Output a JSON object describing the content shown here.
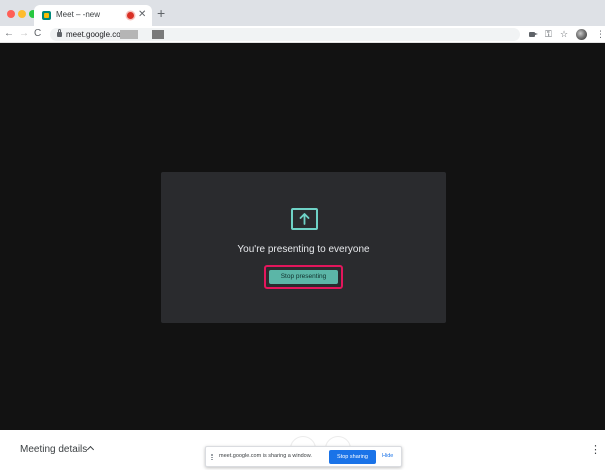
{
  "browser": {
    "tab": {
      "title": "Meet – -new"
    },
    "address_bar": {
      "url": "meet.google.com/"
    }
  },
  "presenting": {
    "heading": "You're presenting to everyone",
    "stop_button": "Stop presenting"
  },
  "bottom_bar": {
    "meeting_details_label": "Meeting details"
  },
  "share_bar": {
    "message": "meet.google.com is sharing a window.",
    "stop_sharing_label": "Stop sharing",
    "hide_label": "Hide"
  },
  "colors": {
    "stage_background": "#121212",
    "card_background": "#2a2b2e",
    "accent_teal": "#5bb6a7",
    "highlight_border": "#e3165c",
    "stop_sharing_blue": "#1a73e8"
  }
}
